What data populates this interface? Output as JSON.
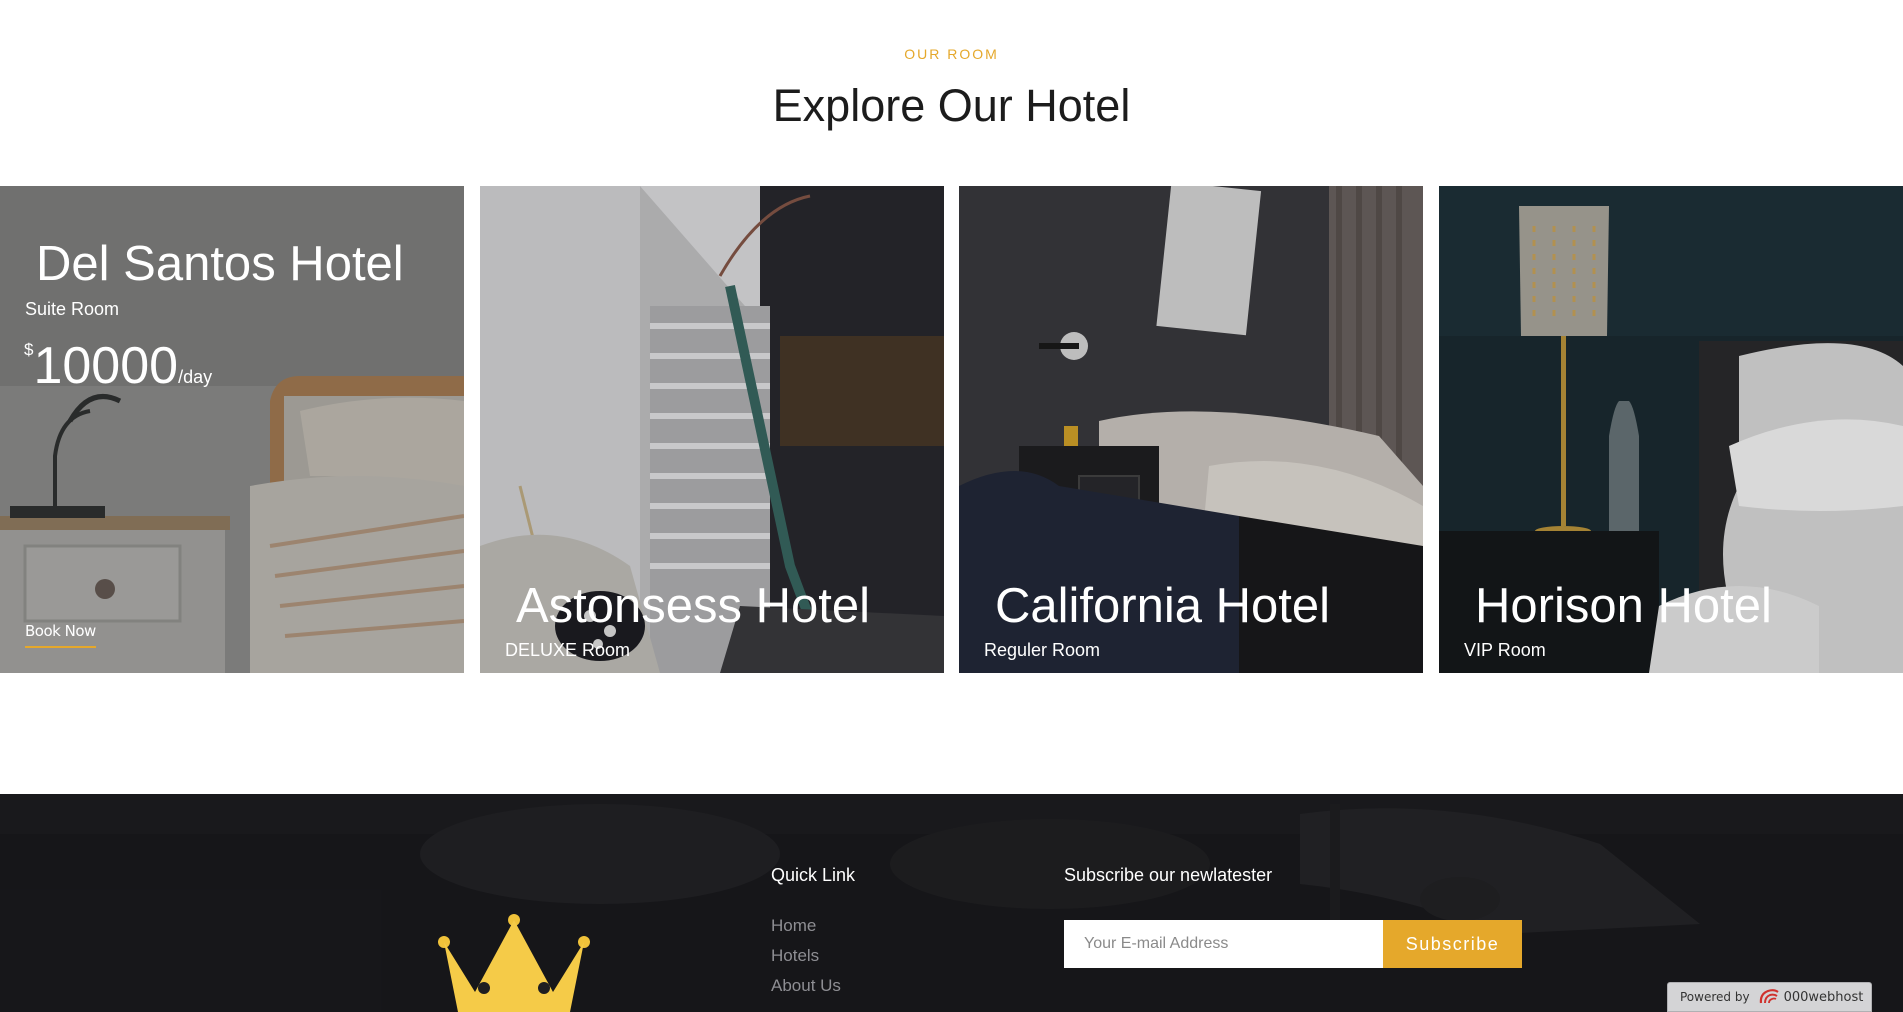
{
  "section": {
    "eyebrow": "OUR ROOM",
    "title": "Explore Our Hotel"
  },
  "cards": [
    {
      "title": "Del Santos Hotel",
      "room": "Suite Room",
      "currency": "$",
      "price": "10000",
      "per": "/day",
      "cta": "Book Now"
    },
    {
      "title": "Astonsess Hotel",
      "room": "DELUXE Room"
    },
    {
      "title": "California Hotel",
      "room": "Reguler Room"
    },
    {
      "title": "Horison Hotel",
      "room": "VIP Room"
    }
  ],
  "footer": {
    "quick_link_title": "Quick Link",
    "links": [
      "Home",
      "Hotels",
      "About Us"
    ],
    "newsletter_title": "Subscribe our newlatester",
    "email_placeholder": "Your E-mail Address",
    "subscribe_label": "Subscribe"
  },
  "powered": {
    "prefix": "Powered by",
    "brand": "000webhost"
  },
  "colors": {
    "accent": "#e5a82b",
    "footer_bg": "#1e1e21",
    "title_text": "#1c1c1c",
    "link_gray": "#8e8e93"
  },
  "icons": {
    "logo": "crown-icon",
    "host": "000webhost-icon"
  }
}
